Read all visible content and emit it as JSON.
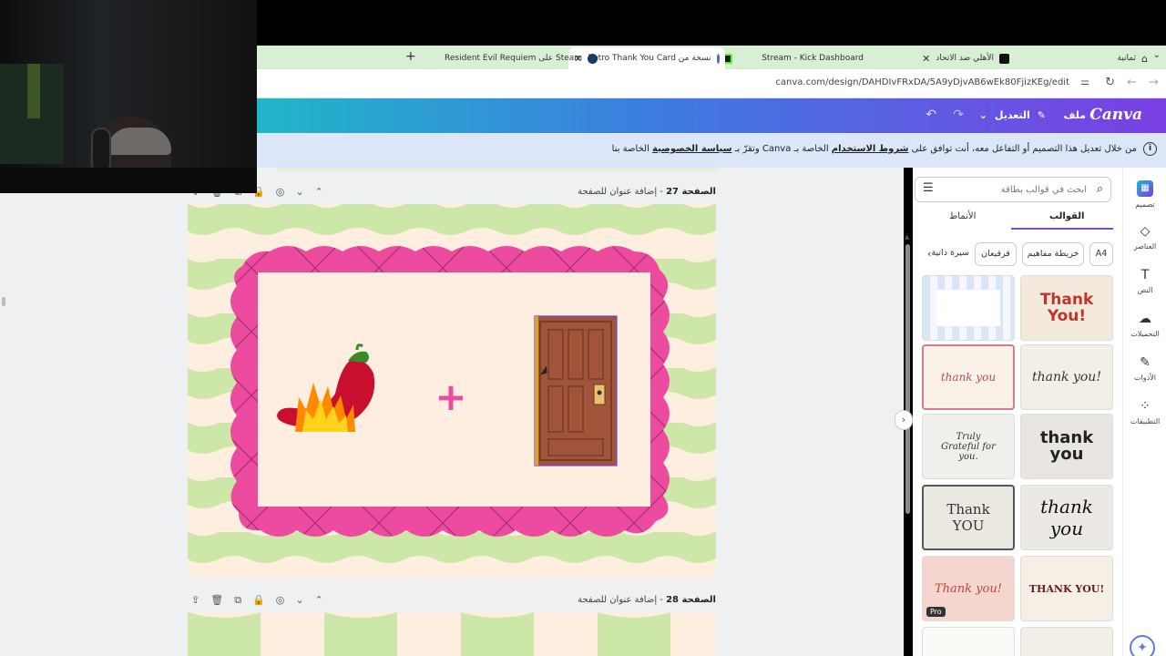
{
  "browser": {
    "tabs": [
      {
        "title": "ثمانية",
        "active": false
      },
      {
        "title": "الأهلي ضد الاتحاد",
        "active": false
      },
      {
        "title": "Stream - Kick Dashboard",
        "active": false
      },
      {
        "title": "Retro Thank You Card نسخة من",
        "active": true
      },
      {
        "title": "Resident Evil Requiem على Steam",
        "active": false
      }
    ],
    "new_tab": "+",
    "url": "canva.com/design/DAHDIvFRxDA/5A9yDjvAB6wEk80FjizKEg/edit"
  },
  "canva_header": {
    "logo": "Canva",
    "file_menu": "ملف",
    "edit_menu": "التعديل"
  },
  "banner": {
    "prefix": "من خلال تعديل هذا التصميم أو التفاعل معه، أنت توافق على ",
    "terms": "شروط الاستخدام",
    "middle": " الخاصة بـ Canva وتقرّ بـ ",
    "privacy": "سياسة الخصوصية",
    "suffix": " الخاصة بنا"
  },
  "pages": [
    {
      "number_label": "الصفحة 27",
      "add_title": " - إضافة عنوان للصفحة"
    },
    {
      "number_label": "الصفحة 28",
      "add_title": " - إضافة عنوان للصفحة"
    }
  ],
  "canvas": {
    "plus_sign": "+"
  },
  "panel": {
    "search_placeholder": "ابحث في قوالب بطاقة",
    "tabs": {
      "templates": "القوالب",
      "styles": "الأنماط"
    },
    "chips": [
      "A4",
      "خريطة مفاهيم",
      "قرقيعان",
      "سيرة ذاتية"
    ],
    "templates": [
      {
        "text": "Thank You!",
        "pro": false,
        "bg": "#f3e9dc",
        "color": "#c0352b"
      },
      {
        "text": "",
        "pro": false,
        "bg": "#d8e6f5",
        "color": "#5b7fb8"
      },
      {
        "text": "thank you!",
        "pro": false,
        "bg": "#f3efe6",
        "color": "#333"
      },
      {
        "text": "thank you",
        "pro": false,
        "bg": "#faf1e8",
        "color": "#b74b5a"
      },
      {
        "text": "thank you",
        "pro": false,
        "bg": "#e9e6e1",
        "color": "#222"
      },
      {
        "text": "Truly Grateful for you.",
        "pro": false,
        "bg": "#f1efec",
        "color": "#333"
      },
      {
        "text": "thank you",
        "pro": false,
        "bg": "#ece9e4",
        "color": "#111"
      },
      {
        "text": "Thank YOU",
        "pro": false,
        "bg": "#ebe8e2",
        "color": "#333"
      },
      {
        "text": "THANK YOU!",
        "pro": false,
        "bg": "#f6efe6",
        "color": "#6b1a1a"
      },
      {
        "text": "Thank you!",
        "pro": true,
        "pro_label": "Pro",
        "bg": "#f4d6cf",
        "color": "#c0453b"
      }
    ]
  },
  "rail": [
    {
      "label": "تصميم",
      "icon": "design-icon",
      "active": true
    },
    {
      "label": "العناصر",
      "icon": "elements-icon",
      "active": false
    },
    {
      "label": "النص",
      "icon": "text-icon",
      "active": false
    },
    {
      "label": "التحميلات",
      "icon": "uploads-icon",
      "active": false
    },
    {
      "label": "الأدوات",
      "icon": "tools-icon",
      "active": false
    },
    {
      "label": "التطبيقات",
      "icon": "apps-icon",
      "active": false
    }
  ],
  "colors": {
    "pink_frame": "#ec4ba0",
    "card_bg": "#fdeedf",
    "checker_green": "#cde7a8",
    "door": "#a0553a",
    "accent_purple": "#7a4ad9"
  }
}
